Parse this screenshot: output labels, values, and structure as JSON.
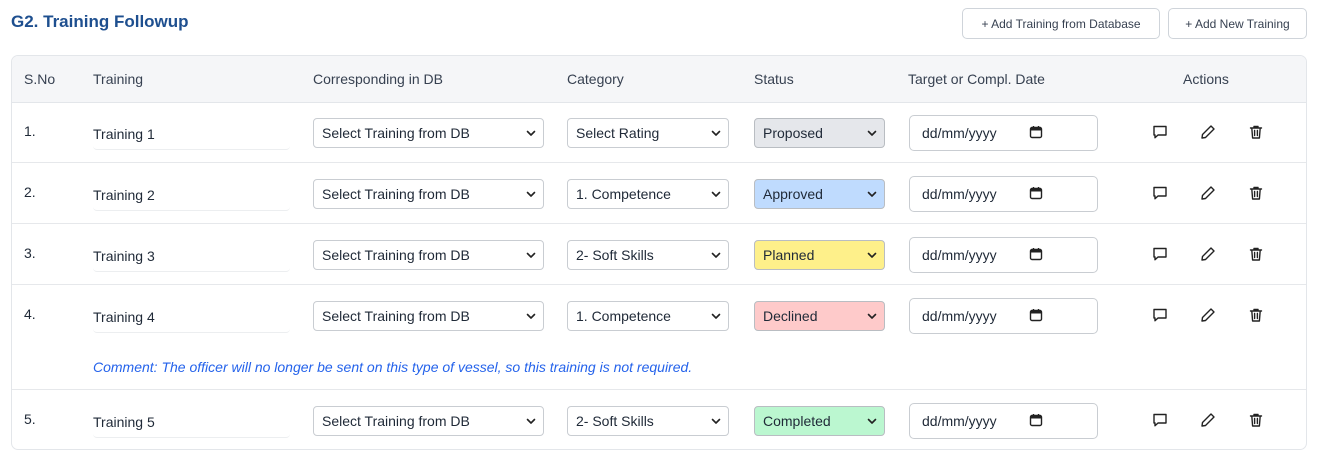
{
  "header": {
    "title": "G2. Training Followup",
    "add_from_db_label": "+ Add Training from Database",
    "add_new_label": "+ Add New Training"
  },
  "table": {
    "columns": {
      "sno": "S.No",
      "training": "Training",
      "corresponding": "Corresponding in DB",
      "category": "Category",
      "status": "Status",
      "date": "Target or Compl. Date",
      "actions": "Actions"
    },
    "rows": [
      {
        "sno": "1.",
        "training": "Training 1",
        "db": "Select Training from DB",
        "category": "Select Rating",
        "status": "Proposed",
        "status_color": "#e5e7eb",
        "date": "dd/mm/yyyy",
        "comment": ""
      },
      {
        "sno": "2.",
        "training": "Training 2",
        "db": "Select Training from DB",
        "category": "1. Competence",
        "status": "Approved",
        "status_color": "#bfdbfe",
        "date": "dd/mm/yyyy",
        "comment": ""
      },
      {
        "sno": "3.",
        "training": "Training 3",
        "db": "Select Training from DB",
        "category": "2- Soft Skills",
        "status": "Planned",
        "status_color": "#fef08a",
        "date": "dd/mm/yyyy",
        "comment": ""
      },
      {
        "sno": "4.",
        "training": "Training 4",
        "db": "Select Training from DB",
        "category": "1. Competence",
        "status": "Declined",
        "status_color": "#fecaca",
        "date": "dd/mm/yyyy",
        "comment": "Comment: The officer will no longer be sent on this type of vessel, so this training is not required."
      },
      {
        "sno": "5.",
        "training": "Training 5",
        "db": "Select Training from DB",
        "category": "2- Soft Skills",
        "status": "Completed",
        "status_color": "#bbf7d0",
        "date": "dd/mm/yyyy",
        "comment": ""
      }
    ]
  },
  "icons": {
    "dropdown": "chevron-down-icon",
    "date": "calendar-icon",
    "comment": "comment-icon",
    "edit": "pencil-icon",
    "delete": "trash-icon"
  },
  "colors": {
    "title": "#1e4f8f",
    "comment_text": "#2563eb"
  }
}
